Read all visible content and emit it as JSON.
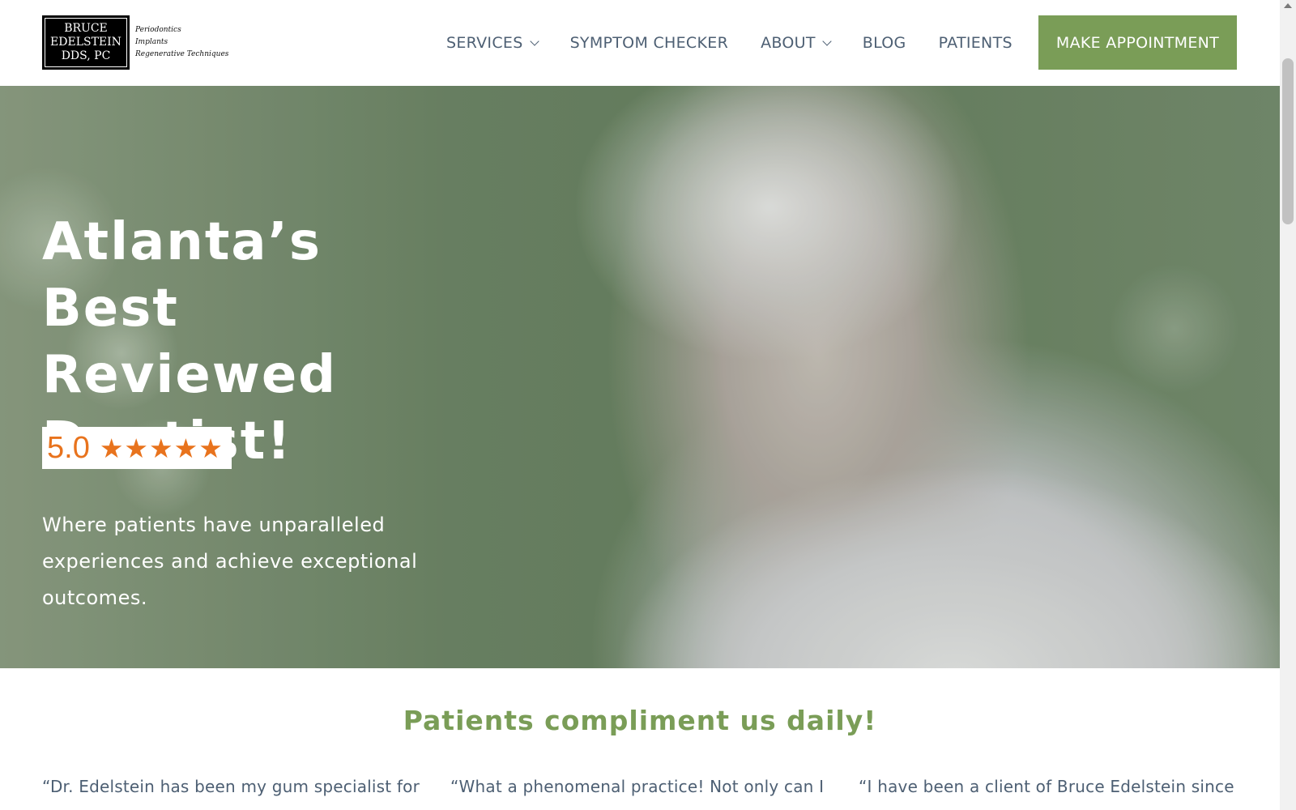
{
  "logo": {
    "line1": "BRUCE",
    "line2": "EDELSTEIN",
    "line3": "DDS, PC",
    "tag1": "Periodontics",
    "tag2": "Implants",
    "tag3": "Regenerative Techniques"
  },
  "nav": {
    "items": [
      {
        "label": "SERVICES",
        "dropdown": true
      },
      {
        "label": "SYMPTOM CHECKER",
        "dropdown": false
      },
      {
        "label": "ABOUT",
        "dropdown": true
      },
      {
        "label": "BLOG",
        "dropdown": false
      },
      {
        "label": "PATIENTS",
        "dropdown": false
      }
    ],
    "cta": "MAKE APPOINTMENT"
  },
  "hero": {
    "title_line1": "Atlanta’s Best",
    "title_line2": "Reviewed",
    "title_line3": "Dentist!",
    "rating": "5.0",
    "stars": 5,
    "subtitle_line1": "Where patients have unparalleled",
    "subtitle_line2": "experiences and achieve exceptional",
    "subtitle_line3": "outcomes."
  },
  "testimonials": {
    "heading": "Patients compliment us daily!",
    "items": [
      "“Dr. Edelstein has been my gum specialist for",
      "“What a phenomenal practice! Not only can I",
      "“I have been a client of Bruce Edelstein since"
    ]
  },
  "colors": {
    "accent": "#7a9d57",
    "nav_text": "#4d5f73",
    "rating_orange": "#e8731d"
  }
}
